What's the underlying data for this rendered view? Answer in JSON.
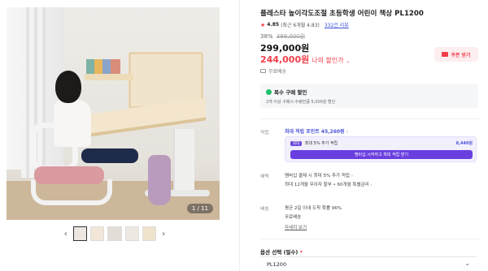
{
  "gallery": {
    "counter": "1 / 11",
    "prev_icon": "chevron-left-icon",
    "next_icon": "chevron-right-icon",
    "thumbnail_count": 5
  },
  "product": {
    "title": "플레스타 높이각도조절 초등학생 어린이 책상 PL1200",
    "rating_score": "4.85",
    "rating_detail": "(최근 6개월 4.83)",
    "review_count": "332건 리뷰",
    "discount_pct": "38%",
    "original_price": "399,000원",
    "price": "299,000원",
    "sale_price": "244,000원",
    "sale_label": "나의 할인가",
    "coupon_label": "쿠폰 받기",
    "free_shipping_tag": "무료배송"
  },
  "multi_purchase": {
    "title": "복수 구매 할인",
    "desc": "2개 이상 구매시 수량만큼 5,000원 할인"
  },
  "points": {
    "label": "적립",
    "summary": "최대 적립 포인트 45,260원",
    "row_badge": "최대",
    "row_text": "최대 5% 추가 적립",
    "row_value": "8,440원",
    "cta": "멤버십 시작하고 최대 적립 받기"
  },
  "benefits": {
    "label": "혜택",
    "line1": "멤버십 결제 시 최대 5% 추가 적립",
    "line2": "최대 12개월 무이자 할부 • 60개월 특별금리"
  },
  "shipping": {
    "label": "배송",
    "line1": "평균 2일 이내 도착 확률 96%",
    "line2": "무료배송",
    "link": "자세히 보기"
  },
  "options": {
    "label": "옵션 선택 (필수)",
    "required_mark": "*",
    "selected": "PL1200"
  },
  "colors": {
    "accent_red": "#f23d4a",
    "accent_purple": "#6a3fe0",
    "link_blue": "#3a52d6",
    "multi_green": "#21c06a"
  }
}
